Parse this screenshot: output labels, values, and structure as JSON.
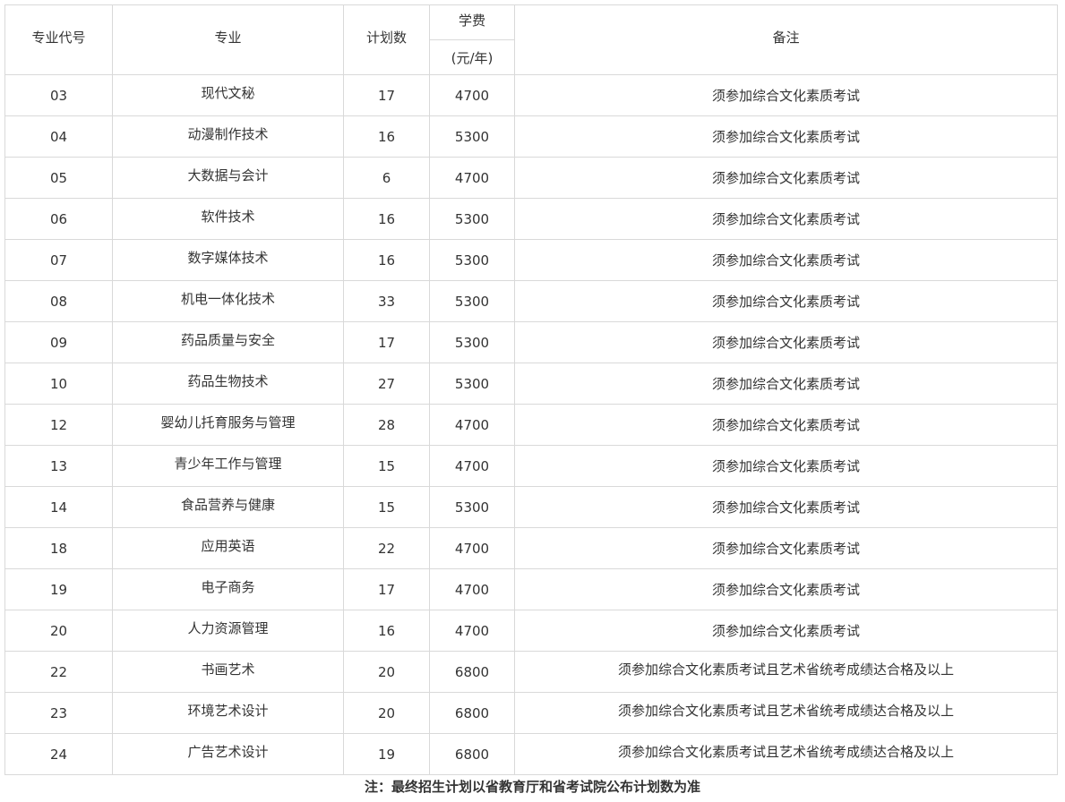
{
  "table": {
    "headers": {
      "code": "专业代号",
      "major": "专业",
      "plan": "计划数",
      "fee_top": "学费",
      "fee_unit": "(元/年)",
      "remark": "备注"
    },
    "rows": [
      {
        "code": "03",
        "major": "现代文秘",
        "plan": "17",
        "fee": "4700",
        "remark": "须参加综合文化素质考试"
      },
      {
        "code": "04",
        "major": "动漫制作技术",
        "plan": "16",
        "fee": "5300",
        "remark": "须参加综合文化素质考试"
      },
      {
        "code": "05",
        "major": "大数据与会计",
        "plan": "6",
        "fee": "4700",
        "remark": "须参加综合文化素质考试"
      },
      {
        "code": "06",
        "major": "软件技术",
        "plan": "16",
        "fee": "5300",
        "remark": "须参加综合文化素质考试"
      },
      {
        "code": "07",
        "major": "数字媒体技术",
        "plan": "16",
        "fee": "5300",
        "remark": "须参加综合文化素质考试"
      },
      {
        "code": "08",
        "major": "机电一体化技术",
        "plan": "33",
        "fee": "5300",
        "remark": "须参加综合文化素质考试"
      },
      {
        "code": "09",
        "major": "药品质量与安全",
        "plan": "17",
        "fee": "5300",
        "remark": "须参加综合文化素质考试"
      },
      {
        "code": "10",
        "major": "药品生物技术",
        "plan": "27",
        "fee": "5300",
        "remark": "须参加综合文化素质考试"
      },
      {
        "code": "12",
        "major": "婴幼儿托育服务与管理",
        "plan": "28",
        "fee": "4700",
        "remark": "须参加综合文化素质考试"
      },
      {
        "code": "13",
        "major": "青少年工作与管理",
        "plan": "15",
        "fee": "4700",
        "remark": "须参加综合文化素质考试"
      },
      {
        "code": "14",
        "major": "食品营养与健康",
        "plan": "15",
        "fee": "5300",
        "remark": "须参加综合文化素质考试"
      },
      {
        "code": "18",
        "major": "应用英语",
        "plan": "22",
        "fee": "4700",
        "remark": "须参加综合文化素质考试"
      },
      {
        "code": "19",
        "major": "电子商务",
        "plan": "17",
        "fee": "4700",
        "remark": "须参加综合文化素质考试"
      },
      {
        "code": "20",
        "major": "人力资源管理",
        "plan": "16",
        "fee": "4700",
        "remark": "须参加综合文化素质考试"
      },
      {
        "code": "22",
        "major": "书画艺术",
        "plan": "20",
        "fee": "6800",
        "remark": "须参加综合文化素质考试且艺术省统考成绩达合格及以上"
      },
      {
        "code": "23",
        "major": "环境艺术设计",
        "plan": "20",
        "fee": "6800",
        "remark": "须参加综合文化素质考试且艺术省统考成绩达合格及以上"
      },
      {
        "code": "24",
        "major": "广告艺术设计",
        "plan": "19",
        "fee": "6800",
        "remark": "须参加综合文化素质考试且艺术省统考成绩达合格及以上"
      }
    ]
  },
  "footnote": "注：最终招生计划以省教育厅和省考试院公布计划数为准"
}
